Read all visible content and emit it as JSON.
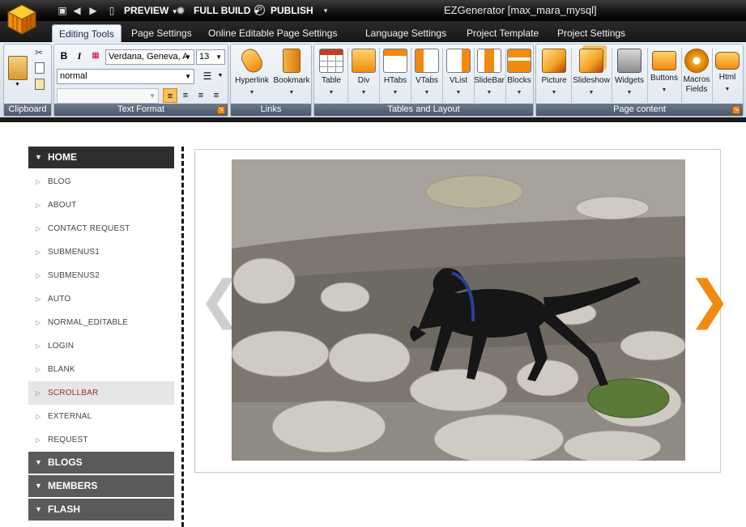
{
  "app": {
    "title": "EZGenerator  [max_mara_mysql]"
  },
  "quick_toolbar": {
    "preview_label": "PREVIEW",
    "full_build_label": "FULL BUILD",
    "publish_label": "PUBLISH"
  },
  "tabs": [
    {
      "label": "Editing Tools",
      "active": true
    },
    {
      "label": "Page Settings"
    },
    {
      "label": "Online Editable Page Settings"
    },
    {
      "label": "Language Settings"
    },
    {
      "label": "Project Template"
    },
    {
      "label": "Project Settings"
    }
  ],
  "ribbon": {
    "groups": {
      "clipboard": "Clipboard",
      "text_format": "Text Format",
      "links": "Links",
      "tables_layout": "Tables and Layout",
      "page_content": "Page content"
    },
    "text_format": {
      "bold": "B",
      "italic": "I",
      "font_family": "Verdana, Geneva, A",
      "font_size": "13",
      "paragraph_style": "normal"
    },
    "links": [
      {
        "label": "Hyperlink",
        "icon": "hyperlink-icon"
      },
      {
        "label": "Bookmark",
        "icon": "bookmark-icon"
      }
    ],
    "tables": [
      {
        "label": "Table",
        "icon": "table-icon"
      },
      {
        "label": "Div",
        "icon": "div-icon"
      },
      {
        "label": "HTabs",
        "icon": "htabs-icon"
      },
      {
        "label": "VTabs",
        "icon": "vtabs-icon"
      },
      {
        "label": "VList",
        "icon": "vlist-icon"
      },
      {
        "label": "SlideBar",
        "icon": "slidebar-icon"
      },
      {
        "label": "Blocks",
        "icon": "blocks-icon"
      }
    ],
    "page_content": [
      {
        "label": "Picture",
        "icon": "picture-icon"
      },
      {
        "label": "Slideshow",
        "icon": "slideshow-icon"
      },
      {
        "label": "Widgets",
        "icon": "widgets-icon"
      },
      {
        "label": "Buttons",
        "icon": "buttons-icon"
      },
      {
        "label": "Macros\nFields",
        "l1": "Macros",
        "l2": "Fields",
        "icon": "macros-icon"
      },
      {
        "label": "Html",
        "icon": "html-icon"
      }
    ]
  },
  "sidebar": {
    "items": [
      {
        "label": "HOME",
        "type": "main"
      },
      {
        "label": "BLOG",
        "type": "sub"
      },
      {
        "label": "ABOUT",
        "type": "sub"
      },
      {
        "label": "CONTACT REQUEST",
        "type": "sub"
      },
      {
        "label": "SUBMENUS1",
        "type": "sub"
      },
      {
        "label": "SUBMENUS2",
        "type": "sub"
      },
      {
        "label": "AUTO",
        "type": "sub"
      },
      {
        "label": "NORMAL_EDITABLE",
        "type": "sub"
      },
      {
        "label": "LOGIN",
        "type": "sub"
      },
      {
        "label": "BLANK",
        "type": "sub"
      },
      {
        "label": "SCROLLBAR",
        "type": "sub",
        "highlighted": true
      },
      {
        "label": "EXTERNAL",
        "type": "sub"
      },
      {
        "label": "REQUEST",
        "type": "sub"
      },
      {
        "label": "BLOGS",
        "type": "main"
      },
      {
        "label": "MEMBERS",
        "type": "main"
      },
      {
        "label": "FLASH",
        "type": "main"
      }
    ]
  },
  "slider": {
    "prev_glyph": "❮",
    "next_glyph": "❯",
    "image_alt": "black dog walking on river rocks"
  },
  "colors": {
    "accent": "#f28a10",
    "menu_dark": "#2e2e2e",
    "menu_main": "#5a5a5a",
    "highlight_text": "#9b2d1f"
  }
}
